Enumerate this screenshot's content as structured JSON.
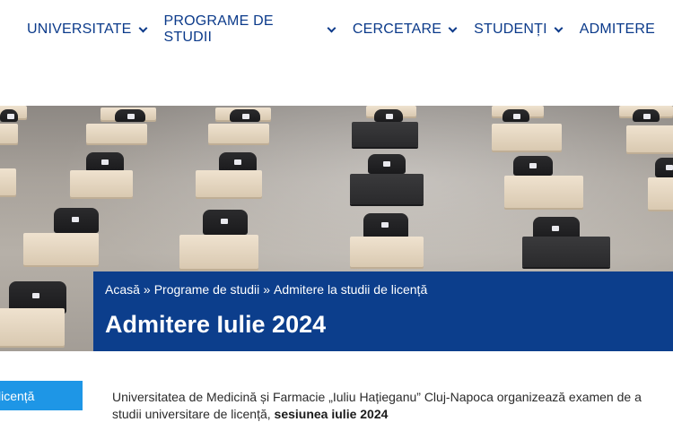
{
  "nav": {
    "items": [
      {
        "label": "UNIVERSITATE",
        "has_dropdown": true
      },
      {
        "label": "PROGRAME DE STUDII",
        "has_dropdown": true
      },
      {
        "label": "CERCETARE",
        "has_dropdown": true
      },
      {
        "label": "STUDENȚI",
        "has_dropdown": true
      },
      {
        "label": "ADMITERE",
        "has_dropdown": false
      }
    ]
  },
  "breadcrumb": {
    "items": [
      "Acasă",
      "Programe de studii",
      "Admitere la studii de licență"
    ],
    "separator": "»"
  },
  "page": {
    "title": "Admitere Iulie 2024"
  },
  "side_tab": {
    "label": "licență"
  },
  "intro": {
    "line1": "Universitatea de Medicină și Farmacie „Iuliu Hațieganu” Cluj-Napoca organizează examen de a",
    "line2_prefix": "studii universitare de licență, ",
    "line2_bold": "sesiunea iulie 2024"
  },
  "colors": {
    "nav_text": "#0b3a8a",
    "title_panel": "#0c3e8c",
    "side_tab": "#1e96e6"
  }
}
